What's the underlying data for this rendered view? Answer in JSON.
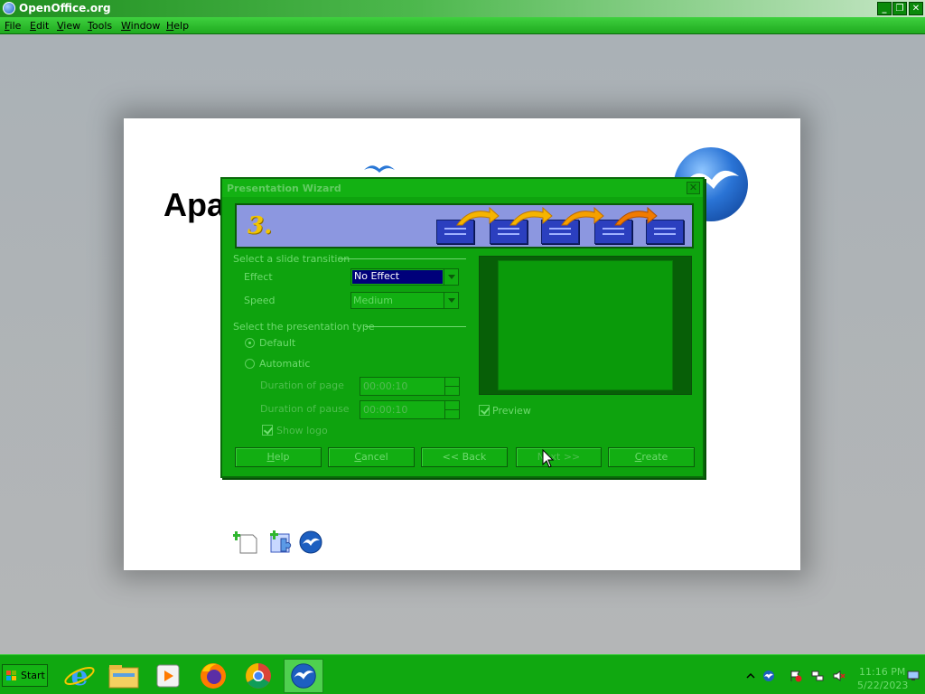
{
  "window": {
    "title": "OpenOffice.org"
  },
  "window_controls": {
    "minimize": "_",
    "restore": "❐",
    "close": "✕"
  },
  "menu": {
    "items": [
      "File",
      "Edit",
      "View",
      "Tools",
      "Window",
      "Help"
    ]
  },
  "slide": {
    "title_fragment": "Apa"
  },
  "dialog": {
    "title": "Presentation Wizard",
    "close_glyph": "✕",
    "step": "3.",
    "transition_group": "Select a slide transition",
    "effect_label": "Effect",
    "effect_value": "No Effect",
    "speed_label": "Speed",
    "speed_value": "Medium",
    "type_group": "Select the presentation type",
    "default_label": "Default",
    "automatic_label": "Automatic",
    "page_duration_label": "Duration of page",
    "page_duration_value": "00:00:10",
    "pause_duration_label": "Duration of pause",
    "pause_duration_value": "00:00:10",
    "show_logo_label": "Show logo",
    "preview_label": "Preview",
    "preview_checked": true,
    "default_selected": true,
    "buttons": {
      "help": "Help",
      "cancel": "Cancel",
      "back": "<< Back",
      "next": "Next >>",
      "create": "Create"
    }
  },
  "taskbar": {
    "start_label": "Start",
    "clock_time": "11:16 PM",
    "clock_date": "5/22/2023"
  },
  "colors": {
    "dialog_bg": "#0ea30e",
    "banner_bg": "#8c97e0",
    "taskbar_bg": "#10a810",
    "selection": "#00007a"
  }
}
